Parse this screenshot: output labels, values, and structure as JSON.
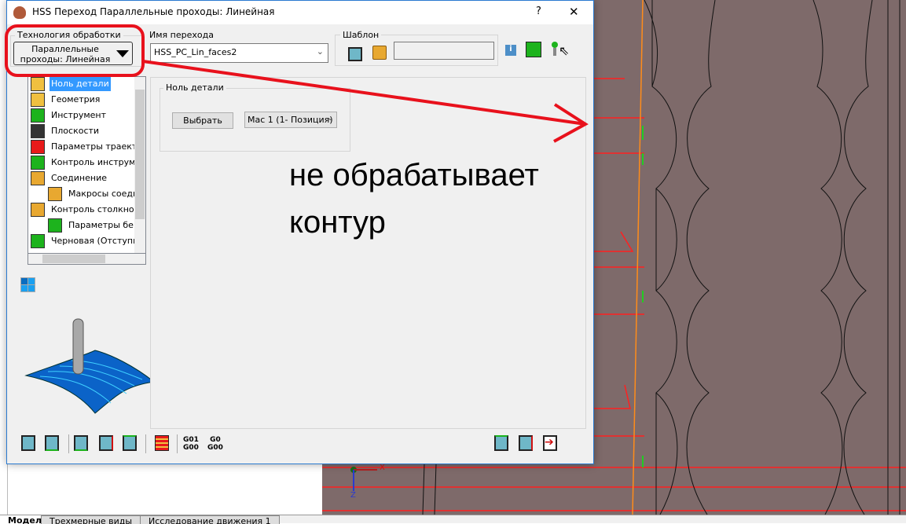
{
  "dialog": {
    "title": "HSS Переход Параллельные проходы: Линейная",
    "help": "?",
    "close": "✕"
  },
  "technology": {
    "label": "Технология обработки",
    "value_line1": "Параллельные",
    "value_line2": "проходы: Линейная"
  },
  "operation_name": {
    "label": "Имя перехода",
    "value": "HSS_PC_Lin_faces2"
  },
  "template": {
    "label": "Шаблон",
    "value": ""
  },
  "tree": {
    "items": [
      {
        "label": "Ноль детали",
        "selected": true
      },
      {
        "label": "Геометрия"
      },
      {
        "label": "Инструмент"
      },
      {
        "label": "Плоскости"
      },
      {
        "label": "Параметры траект"
      },
      {
        "label": "Контроль инструме"
      },
      {
        "label": "Соединение"
      },
      {
        "label": "Макросы соеди"
      },
      {
        "label": "Контроль столкнов"
      },
      {
        "label": "Параметры бе:"
      },
      {
        "label": "Черновая (Отступь"
      }
    ]
  },
  "zero_panel": {
    "group_label": "Ноль детали",
    "select_button": "Выбрать",
    "mac_value": "Mac 1 (1- Позиция)"
  },
  "toolbar": {
    "g01": "G01",
    "g00": "G00",
    "g0": "G0",
    "g00b": "G00"
  },
  "annotation": {
    "line1": "не обрабатывает",
    "line2": "контур",
    "color": "#e8111c"
  },
  "axes": {
    "x": "X",
    "z": "Z"
  },
  "bottom_tabs": [
    "Модель",
    "Трехмерные виды",
    "Исследование движения 1"
  ],
  "colors": {
    "cad_background": "#7e6a6a",
    "selection": "#3399ff",
    "toolpath": "#ff1a1a"
  }
}
